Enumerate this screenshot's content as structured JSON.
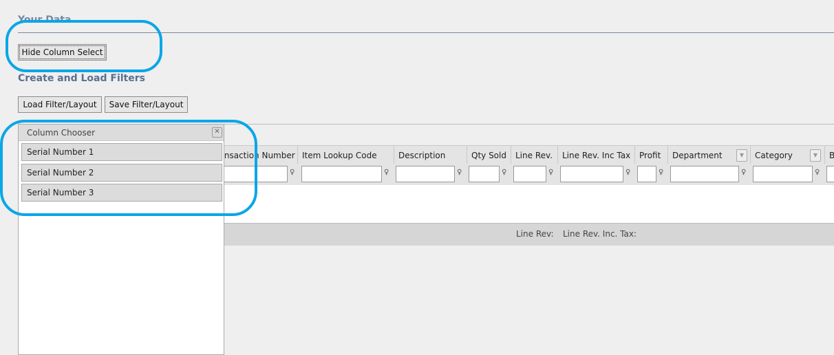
{
  "section_title": "Your Data",
  "hide_column_select": "Hide Column Select",
  "filters_title": "Create and Load Filters",
  "load_filter": "Load Filter/Layout",
  "save_filter": "Save Filter/Layout",
  "chooser": {
    "title": "Column Chooser",
    "close_icon": "close-icon",
    "items": [
      "Serial Number 1",
      "Serial Number 2",
      "Serial Number 3"
    ]
  },
  "columns": [
    "Transaction Number",
    "Item Lookup Code",
    "Description",
    "Qty Sold",
    "Line Rev.",
    "Line Rev. Inc Tax",
    "Profit",
    "Department",
    "Category",
    "B"
  ],
  "footer": {
    "line_rev": "Line Rev:",
    "line_rev_tax": "Line Rev. Inc. Tax:"
  },
  "annotation_color": "#0aa6e8"
}
